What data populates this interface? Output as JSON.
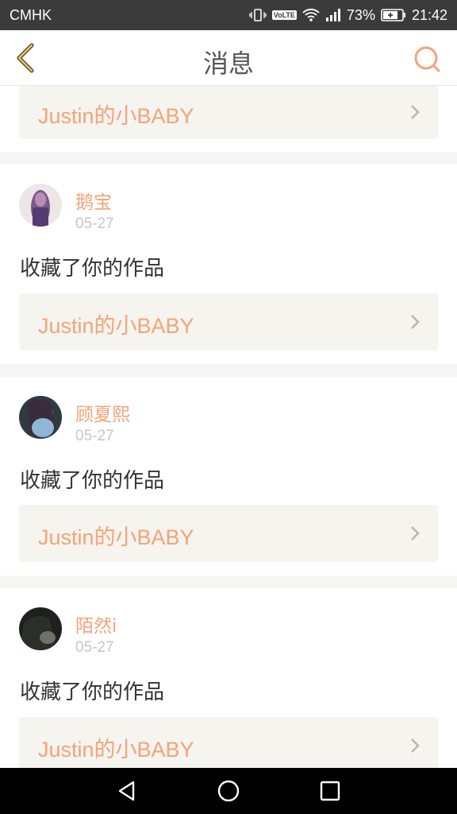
{
  "status_bar": {
    "carrier": "CMHK",
    "volte": "VoLTE",
    "battery": "73%",
    "time": "21:42"
  },
  "header": {
    "title": "消息",
    "back_icon": "chevron-left-icon",
    "search_icon": "search-icon"
  },
  "colors": {
    "accent": "#f3a37a",
    "back_icon": "#f2c94c",
    "card_link_bg": "#f5f4ee"
  },
  "top_partial_card": {
    "work_title": "Justin的小BABY"
  },
  "notifications": [
    {
      "user": "鹅宝",
      "date": "05-27",
      "action": "收藏了你的作品",
      "work_title": "Justin的小BABY"
    },
    {
      "user": "顾夏熙",
      "date": "05-27",
      "action": "收藏了你的作品",
      "work_title": "Justin的小BABY"
    },
    {
      "user": "陌然i",
      "date": "05-27",
      "action": "收藏了你的作品",
      "work_title": "Justin的小BABY"
    }
  ],
  "nav_bar": [
    "back-triangle-icon",
    "home-circle-icon",
    "recents-square-icon"
  ]
}
